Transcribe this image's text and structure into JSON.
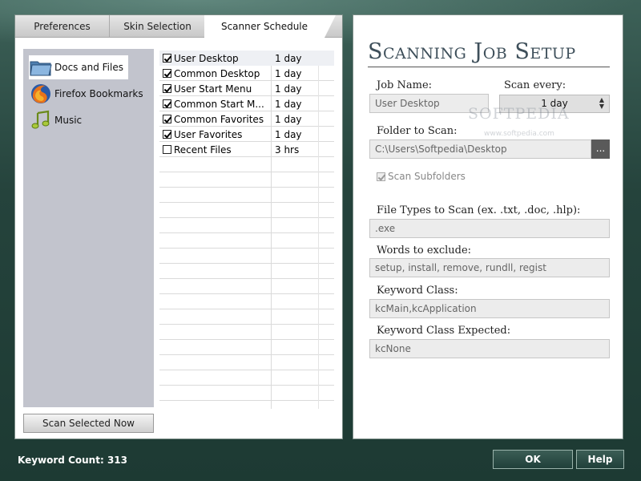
{
  "tabs": [
    {
      "label": "Preferences"
    },
    {
      "label": "Skin Selection"
    },
    {
      "label": "Scanner Schedule"
    }
  ],
  "sidebar": {
    "items": [
      {
        "label": "Docs and Files",
        "icon": "folder-icon"
      },
      {
        "label": "Firefox Bookmarks",
        "icon": "firefox-icon"
      },
      {
        "label": "Music",
        "icon": "music-note-icon"
      }
    ],
    "scan_button": "Scan Selected Now"
  },
  "jobs": [
    {
      "name": "User Desktop",
      "interval": "1 day",
      "checked": true
    },
    {
      "name": "Common Desktop",
      "interval": "1 day",
      "checked": true
    },
    {
      "name": "User Start Menu",
      "interval": "1 day",
      "checked": true
    },
    {
      "name": "Common Start M...",
      "interval": "1 day",
      "checked": true
    },
    {
      "name": "Common Favorites",
      "interval": "1 day",
      "checked": true
    },
    {
      "name": "User Favorites",
      "interval": "1 day",
      "checked": true
    },
    {
      "name": "Recent Files",
      "interval": "3 hrs",
      "checked": false
    }
  ],
  "setup": {
    "title": "Scanning Job Setup",
    "job_name_label": "Job Name:",
    "job_name_value": "User Desktop",
    "scan_every_label": "Scan every:",
    "scan_every_value": "1 day",
    "folder_label": "Folder to Scan:",
    "folder_value": "C:\\Users\\Softpedia\\Desktop",
    "browse_label": "...",
    "subfolders_label": "Scan Subfolders",
    "file_types_label": "File Types to Scan (ex. .txt, .doc, .hlp):",
    "file_types_value": ".exe",
    "exclude_label": "Words to exclude:",
    "exclude_value": "setup, install, remove, rundll, regist",
    "keyword_class_label": "Keyword Class:",
    "keyword_class_value": "kcMain,kcApplication",
    "keyword_expected_label": "Keyword Class Expected:",
    "keyword_expected_value": "kcNone",
    "watermark": "SOFTPEDIA",
    "watermark_url": "www.softpedia.com"
  },
  "footer": {
    "keyword_count_label": "Keyword Count:",
    "keyword_count_value": "313",
    "ok_label": "OK",
    "help_label": "Help"
  },
  "colors": {
    "background": "#25433c",
    "sidebar": "#c2c4cd",
    "title": "#3e4f5a"
  }
}
